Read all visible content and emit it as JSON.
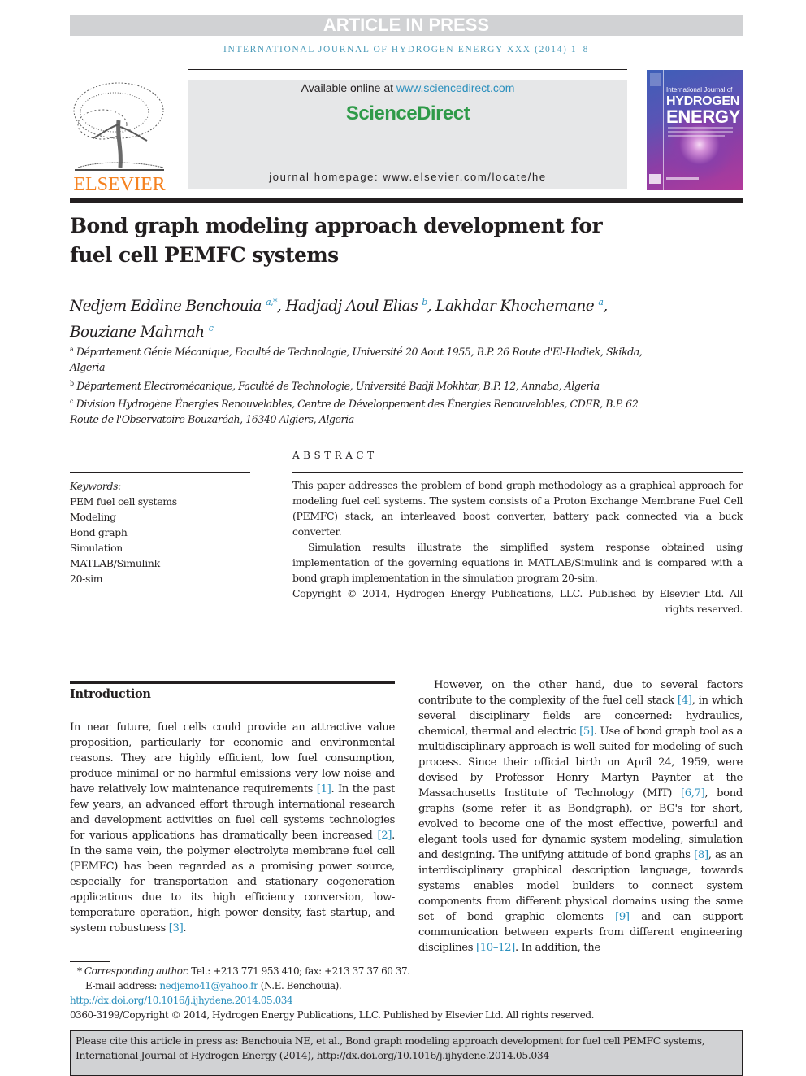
{
  "banner": {
    "text": "ARTICLE IN PRESS"
  },
  "running_header": "INTERNATIONAL JOURNAL OF HYDROGEN ENERGY XXX (2014) 1–8",
  "masthead": {
    "publisher_logo": "ELSEVIER",
    "available_prefix": "Available online at ",
    "available_link": "www.sciencedirect.com",
    "sciencedirect_logo": "ScienceDirect",
    "homepage": "journal homepage: www.elsevier.com/locate/he",
    "cover": {
      "line1": "International Journal of",
      "line2": "HYDROGEN",
      "line3": "ENERGY"
    }
  },
  "article": {
    "title": "Bond graph modeling approach development for fuel cell PEMFC systems",
    "authors": [
      {
        "name": "Nedjem Eddine Benchouia",
        "sup": "a,*"
      },
      {
        "name": "Hadjadj Aoul Elias",
        "sup": "b"
      },
      {
        "name": "Lakhdar Khochemane",
        "sup": "a"
      },
      {
        "name": "Bouziane Mahmah",
        "sup": "c"
      }
    ],
    "affiliations": [
      {
        "label": "a",
        "text": "Département Génie Mécanique, Faculté de Technologie, Université 20 Aout 1955, B.P. 26 Route d'El-Hadiek, Skikda, Algeria"
      },
      {
        "label": "b",
        "text": "Département Electromécanique, Faculté de Technologie, Université Badji Mokhtar, B.P. 12, Annaba, Algeria"
      },
      {
        "label": "c",
        "text": "Division Hydrogène Énergies Renouvelables, Centre de Développement des Énergies Renouvelables, CDER, B.P. 62 Route de l'Observatoire Bouzaréah, 16340 Algiers, Algeria"
      }
    ]
  },
  "keywords": {
    "label": "Keywords:",
    "items": [
      "PEM fuel cell systems",
      "Modeling",
      "Bond graph",
      "Simulation",
      "MATLAB/Simulink",
      "20-sim"
    ]
  },
  "abstract": {
    "heading": "ABSTRACT",
    "p1": "This paper addresses the problem of bond graph methodology as a graphical approach for modeling fuel cell systems. The system consists of a Proton Exchange Membrane Fuel Cell (PEMFC) stack, an interleaved boost converter, battery pack connected via a buck converter.",
    "p2": "Simulation results illustrate the simplified system response obtained using implementation of the governing equations in MATLAB/Simulink and is compared with a bond graph implementation in the simulation program 20-sim.",
    "copyright": "Copyright © 2014, Hydrogen Energy Publications, LLC. Published by Elsevier Ltd. All rights reserved."
  },
  "introduction": {
    "heading": "Introduction",
    "left": {
      "s1": "In near future, fuel cells could provide an attractive value proposition, particularly for economic and environmental reasons. They are highly efficient, low fuel consumption, produce minimal or no harmful emissions very low noise and have relatively low maintenance requirements ",
      "r1": "[1]",
      "s2": ". In the past few years, an advanced effort through international research and development activities on fuel cell systems technologies for various applications has dramatically been increased ",
      "r2": "[2]",
      "s3": ". In the same vein, the polymer electrolyte membrane fuel cell (PEMFC) has been regarded as a promising power source, especially for transportation and stationary cogeneration applications due to its high efficiency conversion, low-temperature operation, high power density, fast startup, and system robustness ",
      "r3": "[3]",
      "s4": "."
    },
    "right": {
      "s1": "However, on the other hand, due to several factors contribute to the complexity of the fuel cell stack ",
      "r4": "[4]",
      "s2": ", in which several disciplinary fields are concerned: hydraulics, chemical, thermal and electric ",
      "r5": "[5]",
      "s3": ". Use of bond graph tool as a multidisciplinary approach is well suited for modeling of such process. Since their official birth on April 24, 1959, were devised by Professor Henry Martyn Paynter at the Massachusetts Institute of Technology (MIT) ",
      "r67": "[6,7]",
      "s4": ", bond graphs (some refer it as Bondgraph), or BG's for short, evolved to become one of the most effective, powerful and elegant tools used for dynamic system modeling, simulation and designing. The unifying attitude of bond graphs ",
      "r8": "[8]",
      "s5": ", as an interdisciplinary graphical description language, towards systems enables model builders to connect system components from different physical domains using the same set of bond graphic elements ",
      "r9": "[9]",
      "s6": " and can support communication between experts from different engineering disciplines ",
      "r1012": "[10–12]",
      "s7": ". In addition, the"
    }
  },
  "footnotes": {
    "corr_label": "Corresponding author.",
    "corr_contact": " Tel.: +213 771 953 410; fax: +213 37 37 60 37.",
    "email_label": "E-mail address: ",
    "email": "nedjemo41@yahoo.fr",
    "email_suffix": " (N.E. Benchouia).",
    "doi": "http://dx.doi.org/10.1016/j.ijhydene.2014.05.034",
    "copyright": "0360-3199/Copyright © 2014, Hydrogen Energy Publications, LLC. Published by Elsevier Ltd. All rights reserved."
  },
  "citation_box": "Please cite this article in press as: Benchouia NE, et al., Bond graph modeling approach development for fuel cell PEMFC systems, International Journal of Hydrogen Energy (2014), http://dx.doi.org/10.1016/j.ijhydene.2014.05.034"
}
